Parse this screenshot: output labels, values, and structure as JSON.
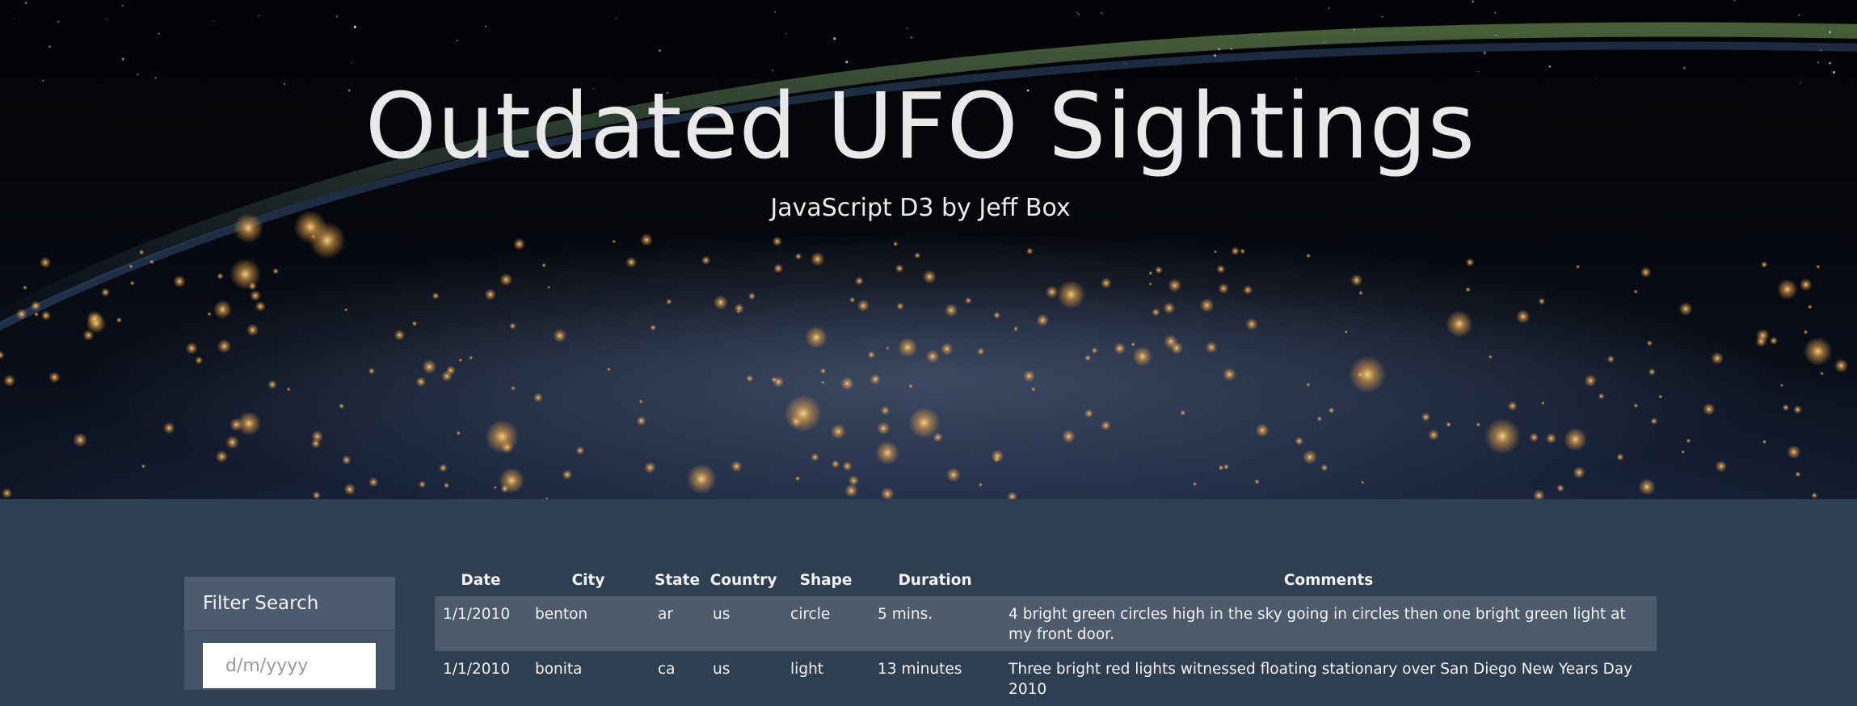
{
  "header": {
    "title": "Outdated UFO Sightings",
    "subtitle": "JavaScript D3 by Jeff Box"
  },
  "filter": {
    "heading": "Filter Search",
    "date_placeholder": "d/m/yyyy",
    "date_value": ""
  },
  "table": {
    "headers": [
      "Date",
      "City",
      "State",
      "Country",
      "Shape",
      "Duration",
      "Comments"
    ],
    "rows": [
      {
        "date": "1/1/2010",
        "city": "benton",
        "state": "ar",
        "country": "us",
        "shape": "circle",
        "duration": "5 mins.",
        "comments": "4 bright green circles high in the sky going in circles then one bright green light at my front door."
      },
      {
        "date": "1/1/2010",
        "city": "bonita",
        "state": "ca",
        "country": "us",
        "shape": "light",
        "duration": "13 minutes",
        "comments": "Three bright red lights witnessed floating stationary over San Diego New Years Day 2010"
      }
    ]
  },
  "colors": {
    "page_background": "#2f3f52",
    "panel_header": "#4c5b6e",
    "striped_row": "#4d5b6d",
    "text": "#f2f2f2"
  },
  "icons": {
    "hero": "earth-at-night-image"
  }
}
